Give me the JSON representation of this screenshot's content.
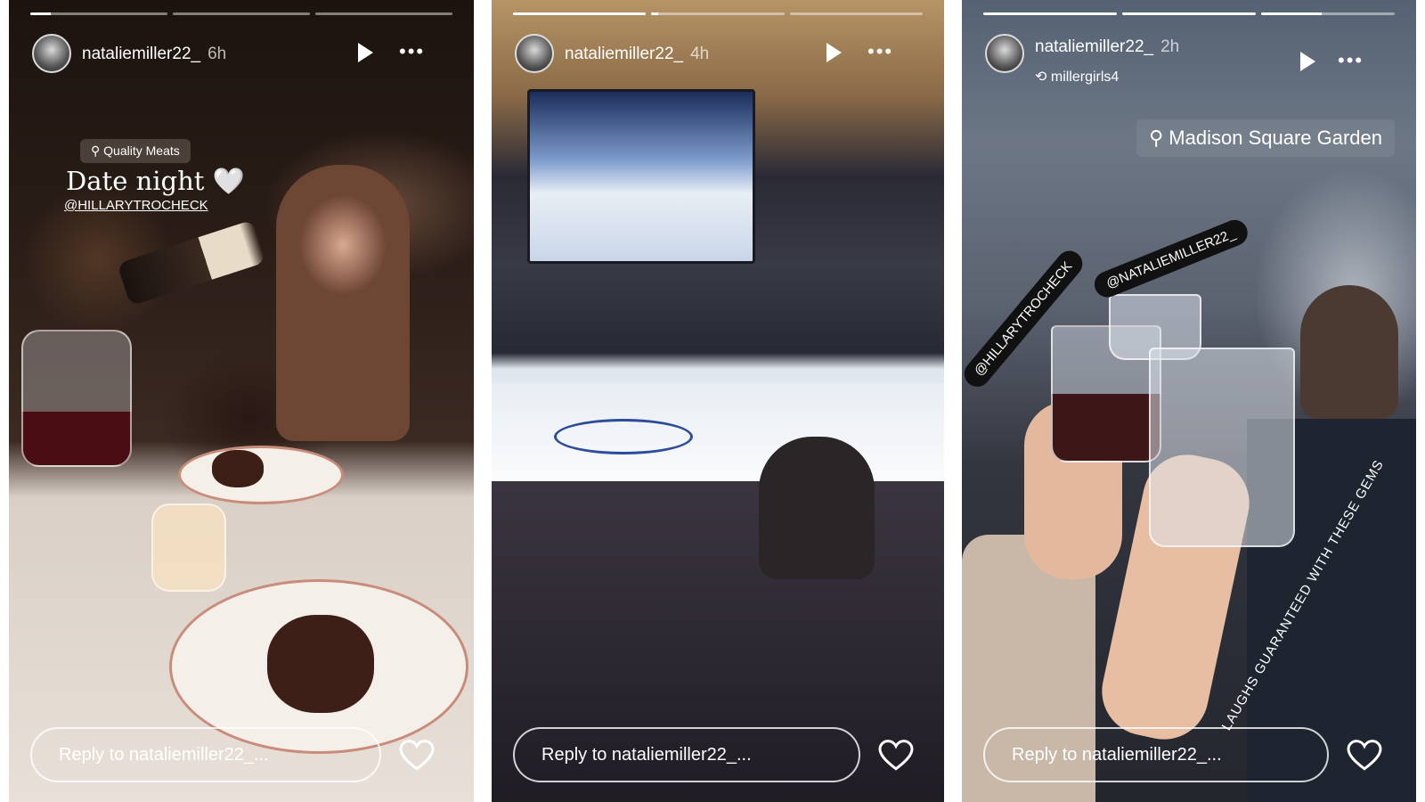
{
  "stories": [
    {
      "username": "nataliemiller22_",
      "age": "6h",
      "location": "Quality Meats",
      "caption": "Date night 🤍",
      "mention": "@HILLARYTROCHECK",
      "reply_placeholder": "Reply to nataliemiller22_...",
      "progress": [
        0.15,
        0,
        0
      ]
    },
    {
      "username": "nataliemiller22_",
      "age": "4h",
      "reply_placeholder": "Reply to nataliemiller22_...",
      "progress": [
        1,
        0.05,
        0
      ]
    },
    {
      "username": "nataliemiller22_",
      "age": "2h",
      "reposted_from": "millergirls4",
      "location": "Madison Square Garden",
      "mention_a": "@HILLARYTROCHECK",
      "mention_b": "@NATALIEMILLER22_",
      "caption": "LAUGHS GUARANTEED WITH THESE GEMS",
      "reply_placeholder": "Reply to nataliemiller22_...",
      "progress": [
        1,
        1,
        0.45
      ]
    }
  ],
  "icons": {
    "play": "play-icon",
    "more": "more-icon",
    "heart": "heart-icon",
    "location": "location-pin-icon",
    "repost": "repost-icon"
  }
}
